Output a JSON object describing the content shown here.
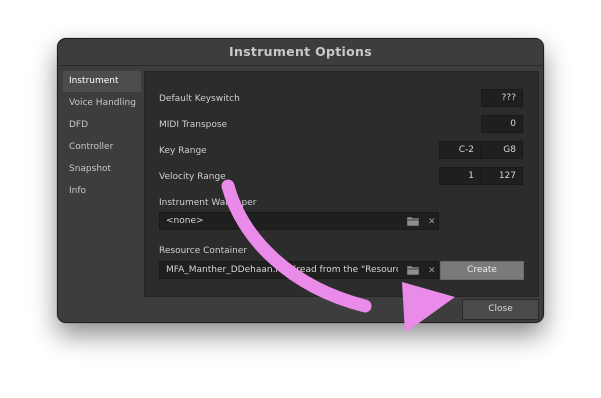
{
  "window": {
    "title": "Instrument Options"
  },
  "sidebar": {
    "items": [
      {
        "label": "Instrument"
      },
      {
        "label": "Voice Handling"
      },
      {
        "label": "DFD"
      },
      {
        "label": "Controller"
      },
      {
        "label": "Snapshot"
      },
      {
        "label": "Info"
      }
    ]
  },
  "instrument": {
    "default_keyswitch": {
      "label": "Default Keyswitch",
      "value": "???"
    },
    "midi_transpose": {
      "label": "MIDI Transpose",
      "value": "0"
    },
    "key_range": {
      "label": "Key Range",
      "low": "C-2",
      "high": "G8"
    },
    "velocity_range": {
      "label": "Velocity Range",
      "low": "1",
      "high": "127"
    },
    "wallpaper": {
      "label": "Instrument Wallpaper",
      "value": "<none>"
    },
    "resource_container": {
      "label": "Resource Container",
      "value": "MFA_Manther_DDehaan.nkr (read from the \"Resource",
      "create_label": "Create"
    }
  },
  "footer": {
    "close_label": "Close"
  },
  "colors": {
    "annotation_arrow": "#ea8be9"
  },
  "icons": {
    "browse": "folder-icon",
    "clear": "close-icon",
    "annotation": "arrow-annotation"
  }
}
